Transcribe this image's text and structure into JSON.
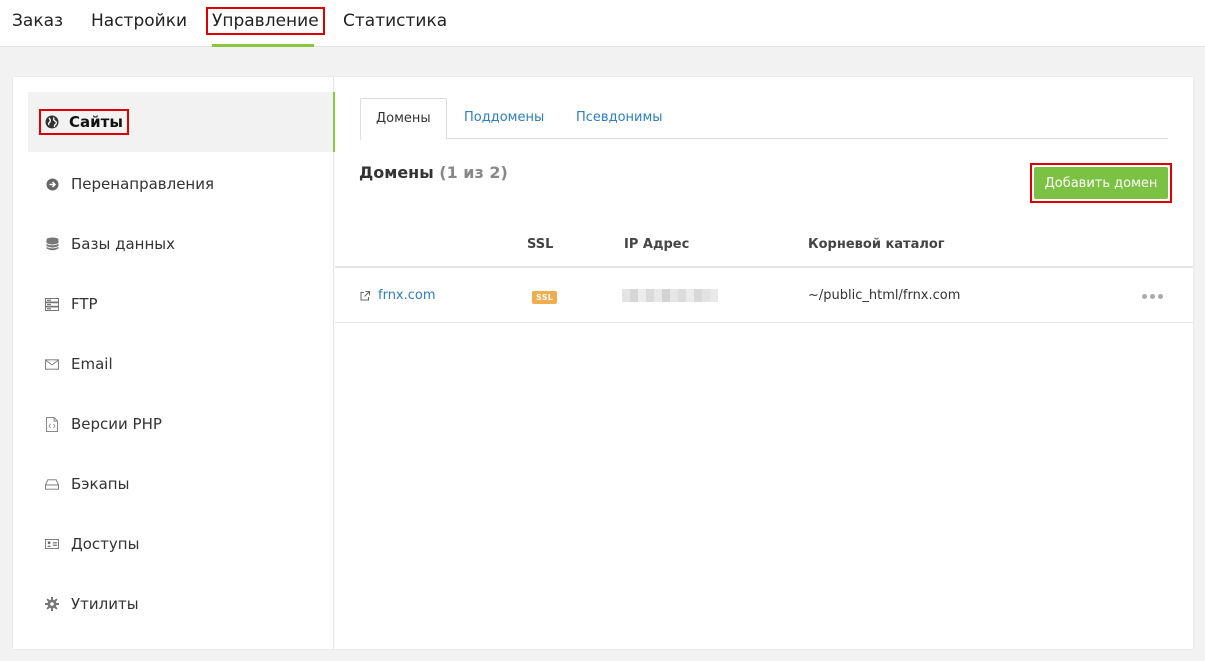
{
  "topnav": {
    "items": [
      {
        "label": "Заказ"
      },
      {
        "label": "Настройки"
      },
      {
        "label": "Управление",
        "active": true
      },
      {
        "label": "Статистика"
      }
    ]
  },
  "sidebar": {
    "items": [
      {
        "label": "Сайты",
        "icon": "globe-icon",
        "active": true
      },
      {
        "label": "Перенаправления",
        "icon": "arrow-circle-icon"
      },
      {
        "label": "Базы данных",
        "icon": "database-icon"
      },
      {
        "label": "FTP",
        "icon": "server-icon"
      },
      {
        "label": "Email",
        "icon": "envelope-icon"
      },
      {
        "label": "Версии PHP",
        "icon": "code-file-icon"
      },
      {
        "label": "Бэкапы",
        "icon": "drive-icon"
      },
      {
        "label": "Доступы",
        "icon": "id-card-icon"
      },
      {
        "label": "Утилиты",
        "icon": "gear-icon"
      }
    ]
  },
  "tabs": [
    {
      "label": "Домены",
      "active": true
    },
    {
      "label": "Поддомены"
    },
    {
      "label": "Псевдонимы"
    }
  ],
  "section": {
    "title": "Домены",
    "count": "(1 из 2)",
    "add_button": "Добавить домен"
  },
  "table": {
    "columns": [
      "SSL",
      "IP Адрес",
      "Корневой каталог"
    ],
    "rows": [
      {
        "domain": "frnx.com",
        "ssl": "SSL",
        "ip": "",
        "root": "~/public_html/frnx.com"
      }
    ]
  },
  "colors": {
    "accent_green": "#7cc242",
    "link_blue": "#2b7fc1",
    "ssl_orange": "#f0ad4e",
    "highlight_red": "#e00000"
  }
}
